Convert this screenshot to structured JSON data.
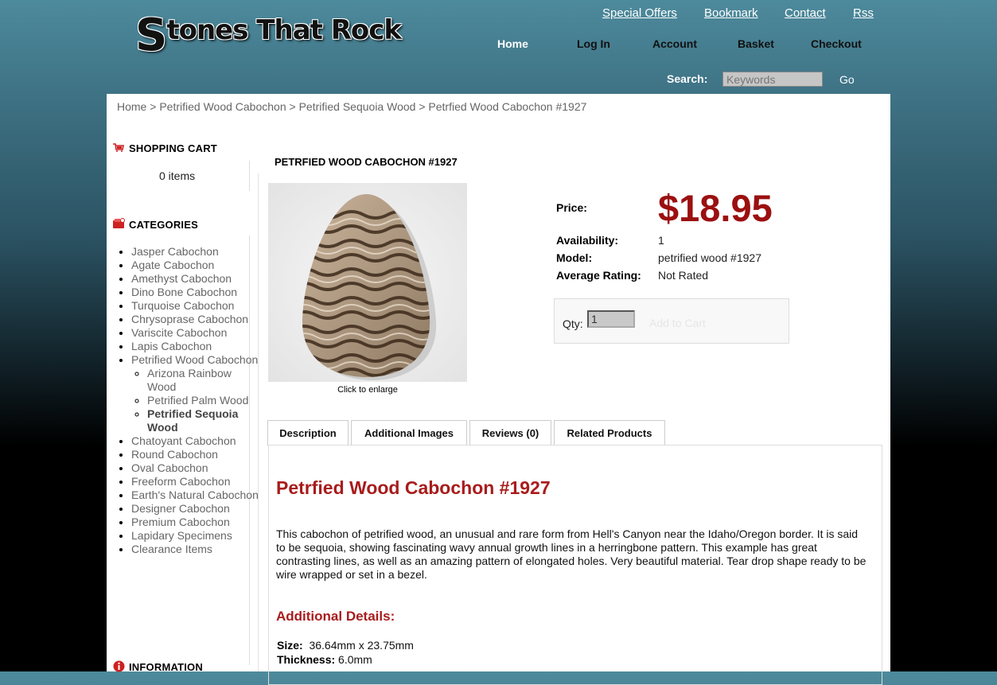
{
  "header": {
    "logo_first_letter": "S",
    "logo_rest": "tones That Rock",
    "top_links": [
      "Special Offers",
      "Bookmark",
      "Contact",
      "Rss"
    ],
    "nav": [
      "Home",
      "Log In",
      "Account",
      "Basket",
      "Checkout"
    ],
    "search_label": "Search:",
    "search_placeholder": "Keywords",
    "search_go": "Go"
  },
  "breadcrumb": [
    "Home",
    "Petrified Wood Cabochon",
    "Petrified Sequoia Wood",
    "Petrfied Wood Cabochon #1927"
  ],
  "breadcrumb_separator": " > ",
  "sidebar": {
    "cart_title": "SHOPPING CART",
    "cart_items": "0 items",
    "categories_title": "CATEGORIES",
    "categories_before": [
      "Jasper Cabochon",
      "Agate Cabochon",
      "Amethyst Cabochon",
      "Dino Bone Cabochon",
      "Turquoise Cabochon",
      "Chrysoprase Cabochon",
      "Variscite Cabochon",
      "Lapis Cabochon",
      "Petrified Wood Cabochon"
    ],
    "subcategories": [
      "Arizona Rainbow Wood",
      "Petrified Palm Wood",
      "Petrified Sequoia Wood"
    ],
    "categories_after": [
      "Chatoyant Cabochon",
      "Round Cabochon",
      "Oval Cabochon",
      "Freeform Cabochon",
      "Earth's Natural Cabochon",
      "Designer Cabochon",
      "Premium Cabochon",
      "Lapidary Specimens",
      "Clearance Items"
    ],
    "info_title": "INFORMATION"
  },
  "product": {
    "heading": "PETRFIED WOOD CABOCHON #1927",
    "click_enlarge": "Click to enlarge",
    "price_label": "Price:",
    "price": "$18.95",
    "availability_label": "Availability:",
    "availability": "1",
    "model_label": "Model:",
    "model": "petrified wood #1927",
    "rating_label": "Average Rating:",
    "rating": "Not Rated",
    "qty_label": "Qty:",
    "qty_value": "1",
    "add_to_cart": "Add to Cart"
  },
  "tabs": [
    "Description",
    "Additional Images",
    "Reviews (0)",
    "Related Products"
  ],
  "description": {
    "title": "Petrfied Wood Cabochon #1927",
    "text": "This cabochon of petrified wood, an unusual and rare form from Hell's Canyon near the Idaho/Oregon border. It is said to be sequoia, showing fascinating wavy annual growth lines in a herringbone pattern. This example has great contrasting lines, as well as an amazing pattern of elongated holes. Very beautiful material. Tear drop shape ready to be wire wrapped or set in a bezel.",
    "additional_title": "Additional Details:",
    "size_label": "Size:",
    "size": "36.64mm x 23.75mm",
    "thickness_label": "Thickness:",
    "thickness": "6.0mm"
  },
  "colors": {
    "price": "#9b1010",
    "desc_title": "#a81c1c"
  }
}
